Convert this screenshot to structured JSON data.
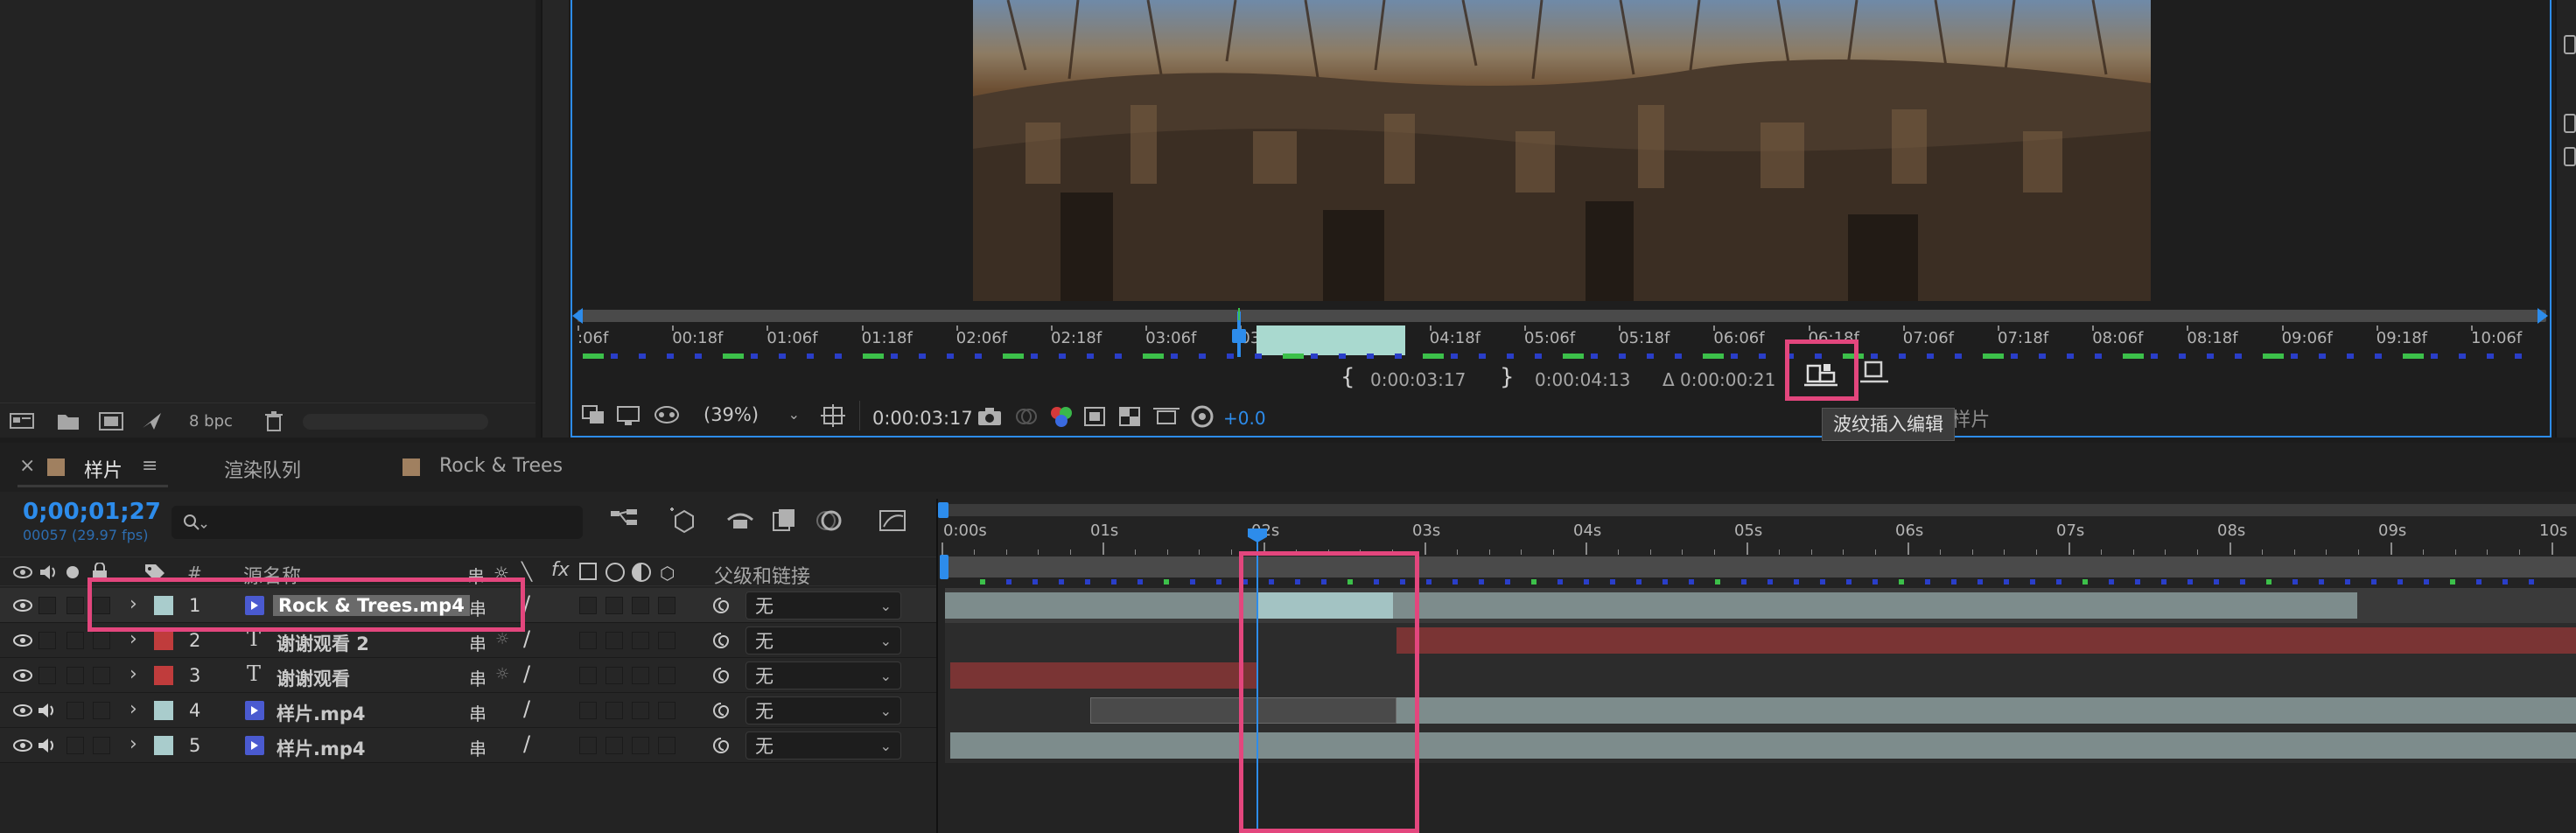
{
  "project_panel": {
    "bpc_label": "8 bpc"
  },
  "viewer": {
    "ruler_labels": [
      ":06f",
      "00:18f",
      "01:06f",
      "01:18f",
      "02:06f",
      "02:18f",
      "03:06f",
      "03:18f",
      "04:06f",
      "04:18f",
      "05:06f",
      "05:18f",
      "06:06f",
      "06:18f",
      "07:06f",
      "07:18f",
      "08:06f",
      "08:18f",
      "09:06f",
      "09:18f",
      "10:06f"
    ],
    "in_point": "0:00:03:17",
    "out_point": "0:00:04:13",
    "duration": "Δ 0:00:00:21",
    "zoom": "(39%)",
    "current_time": "0:00:03:17",
    "exposure": "+0.0",
    "tooltip": "波纹插入编辑",
    "partially_hidden_label": "编辑目标: 样片"
  },
  "tabs": [
    {
      "label": "样片",
      "menu": "≡",
      "close": "×",
      "swatch": "#a08060"
    },
    {
      "label": "渲染队列"
    },
    {
      "label": "Rock & Trees",
      "swatch": "#a08060"
    }
  ],
  "timeline": {
    "timecode": "0;00;01;27",
    "frame_info": "00057 (29.97 fps)",
    "search_placeholder": "",
    "column_headers": {
      "number": "#",
      "source_name": "源名称",
      "parent": "父级和链接"
    },
    "ruler_labels": [
      "0:00s",
      "01s",
      "02s",
      "03s",
      "04s",
      "05s",
      "06s",
      "07s",
      "08s",
      "09s",
      "10s"
    ],
    "layers": [
      {
        "num": "1",
        "name": "Rock & Trees.mp4",
        "type": "video",
        "color": "#a9cccc",
        "parent": "无",
        "selected": true
      },
      {
        "num": "2",
        "name": "谢谢观看 2",
        "type": "text",
        "color": "#c03c3c",
        "parent": "无"
      },
      {
        "num": "3",
        "name": "谢谢观看",
        "type": "text",
        "color": "#c03c3c",
        "parent": "无"
      },
      {
        "num": "4",
        "name": "样片.mp4",
        "type": "video",
        "color": "#a9cccc",
        "parent": "无"
      },
      {
        "num": "5",
        "name": "样片.mp4",
        "type": "video",
        "color": "#a9cccc",
        "parent": "无"
      }
    ]
  },
  "colors": {
    "accent_blue": "#2d8ceb",
    "highlight_pink": "#e3467d",
    "work_area_green": "#a9d9cf",
    "red_label": "#c03c3c",
    "aqua_label": "#a9cccc"
  }
}
